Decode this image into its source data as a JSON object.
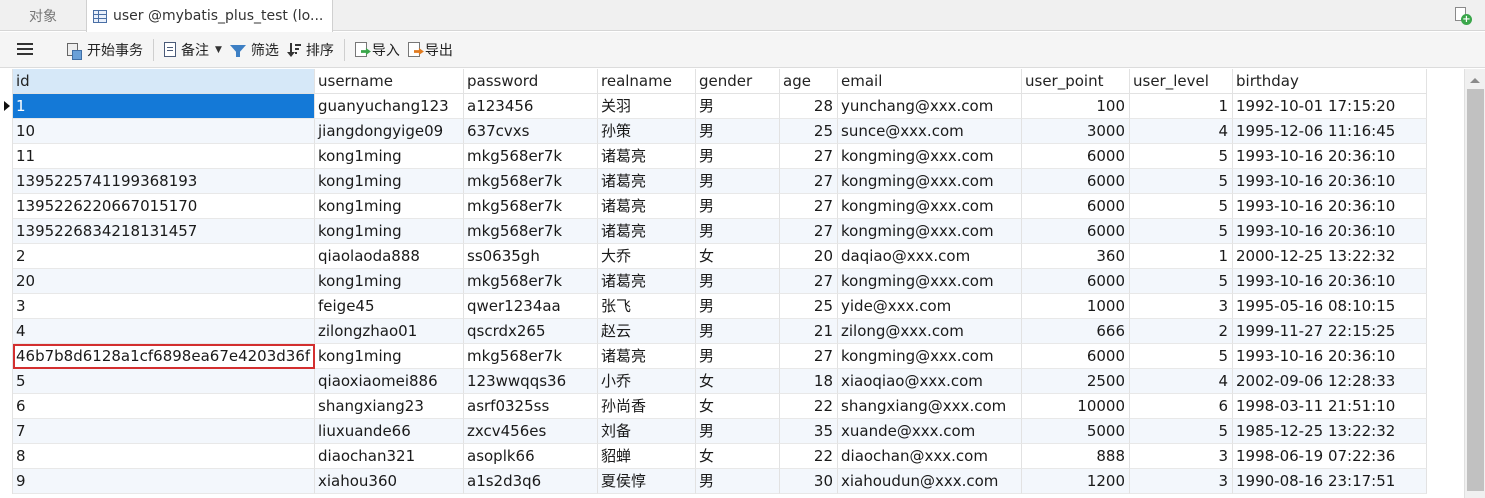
{
  "tabs": {
    "objects_label": "对象",
    "active_label": "user @mybatis_plus_test (lo..."
  },
  "toolbar": {
    "begin_transaction": "开始事务",
    "note": "备注",
    "filter": "筛选",
    "sort": "排序",
    "import": "导入",
    "export": "导出"
  },
  "table": {
    "columns": [
      "id",
      "username",
      "password",
      "realname",
      "gender",
      "age",
      "email",
      "user_point",
      "user_level",
      "birthday"
    ],
    "selected_column": "id",
    "current_row": 0,
    "focused_row": 10,
    "rows": [
      [
        "1",
        "guanyuchang123",
        "a123456",
        "关羽",
        "男",
        "28",
        "yunchang@xxx.com",
        "100",
        "1",
        "1992-10-01 17:15:20"
      ],
      [
        "10",
        "jiangdongyige09",
        "637cvxs",
        "孙策",
        "男",
        "25",
        "sunce@xxx.com",
        "3000",
        "4",
        "1995-12-06 11:16:45"
      ],
      [
        "11",
        "kong1ming",
        "mkg568er7k",
        "诸葛亮",
        "男",
        "27",
        "kongming@xxx.com",
        "6000",
        "5",
        "1993-10-16 20:36:10"
      ],
      [
        "1395225741199368193",
        "kong1ming",
        "mkg568er7k",
        "诸葛亮",
        "男",
        "27",
        "kongming@xxx.com",
        "6000",
        "5",
        "1993-10-16 20:36:10"
      ],
      [
        "1395226220667015170",
        "kong1ming",
        "mkg568er7k",
        "诸葛亮",
        "男",
        "27",
        "kongming@xxx.com",
        "6000",
        "5",
        "1993-10-16 20:36:10"
      ],
      [
        "1395226834218131457",
        "kong1ming",
        "mkg568er7k",
        "诸葛亮",
        "男",
        "27",
        "kongming@xxx.com",
        "6000",
        "5",
        "1993-10-16 20:36:10"
      ],
      [
        "2",
        "qiaolaoda888",
        "ss0635gh",
        "大乔",
        "女",
        "20",
        "daqiao@xxx.com",
        "360",
        "1",
        "2000-12-25 13:22:32"
      ],
      [
        "20",
        "kong1ming",
        "mkg568er7k",
        "诸葛亮",
        "男",
        "27",
        "kongming@xxx.com",
        "6000",
        "5",
        "1993-10-16 20:36:10"
      ],
      [
        "3",
        "feige45",
        "qwer1234aa",
        "张飞",
        "男",
        "25",
        "yide@xxx.com",
        "1000",
        "3",
        "1995-05-16 08:10:15"
      ],
      [
        "4",
        "zilongzhao01",
        "qscrdx265",
        "赵云",
        "男",
        "21",
        "zilong@xxx.com",
        "666",
        "2",
        "1999-11-27 22:15:25"
      ],
      [
        "46b7b8d6128a1cf6898ea67e4203d36f",
        "kong1ming",
        "mkg568er7k",
        "诸葛亮",
        "男",
        "27",
        "kongming@xxx.com",
        "6000",
        "5",
        "1993-10-16 20:36:10"
      ],
      [
        "5",
        "qiaoxiaomei886",
        "123wwqqs36",
        "小乔",
        "女",
        "18",
        "xiaoqiao@xxx.com",
        "2500",
        "4",
        "2002-09-06 12:28:33"
      ],
      [
        "6",
        "shangxiang23",
        "asrf0325ss",
        "孙尚香",
        "女",
        "22",
        "shangxiang@xxx.com",
        "10000",
        "6",
        "1998-03-11 21:51:10"
      ],
      [
        "7",
        "liuxuande66",
        "zxcv456es",
        "刘备",
        "男",
        "35",
        "xuande@xxx.com",
        "5000",
        "5",
        "1985-12-25 13:22:32"
      ],
      [
        "8",
        "diaochan321",
        "asoplk66",
        "貂蝉",
        "女",
        "22",
        "diaochan@xxx.com",
        "888",
        "3",
        "1998-06-19 07:22:36"
      ],
      [
        "9",
        "xiahou360",
        "a1s2d3q6",
        "夏侯惇",
        "男",
        "30",
        "xiahoudun@xxx.com",
        "1200",
        "3",
        "1990-08-16 23:17:51"
      ]
    ]
  },
  "colors": {
    "selection": "#1479d7",
    "header_selected": "#d6e8f8",
    "focus_outline": "#d32f2f",
    "alt_row": "#f3f7fc"
  },
  "icons": {
    "menu": "hamburger-icon",
    "table_tab": "table-grid-icon",
    "new_tab": "add-document-icon"
  }
}
